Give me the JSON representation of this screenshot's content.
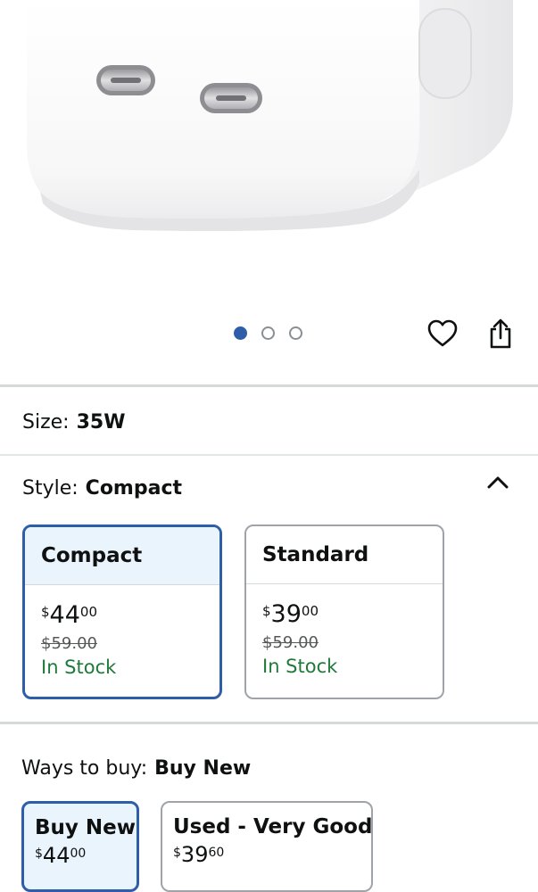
{
  "product": {
    "image_icon": "usb-c-dual-charger-image"
  },
  "carousel": {
    "total": 3,
    "active_index": 1
  },
  "actions": {
    "favorite_icon": "heart-icon",
    "share_icon": "share-icon"
  },
  "size": {
    "label": "Size:",
    "value": "35W"
  },
  "style": {
    "label": "Style:",
    "value": "Compact",
    "options": [
      {
        "name": "Compact",
        "currency": "$",
        "price_whole": "44",
        "price_fraction": "00",
        "list_price": "$59.00",
        "availability": "In Stock",
        "selected": true
      },
      {
        "name": "Standard",
        "currency": "$",
        "price_whole": "39",
        "price_fraction": "00",
        "list_price": "$59.00",
        "availability": "In Stock",
        "selected": false
      }
    ]
  },
  "ways_to_buy": {
    "label": "Ways to buy:",
    "value": "Buy New",
    "options": [
      {
        "name": "Buy New",
        "currency": "$",
        "price_whole": "44",
        "price_fraction": "00",
        "selected": true
      },
      {
        "name": "Used - Very Good",
        "currency": "$",
        "price_whole": "39",
        "price_fraction": "60",
        "selected": false
      }
    ]
  },
  "colors": {
    "accent": "#2e5ea8",
    "in_stock": "#1f7a3a",
    "selected_bg": "#eaf4fd"
  }
}
